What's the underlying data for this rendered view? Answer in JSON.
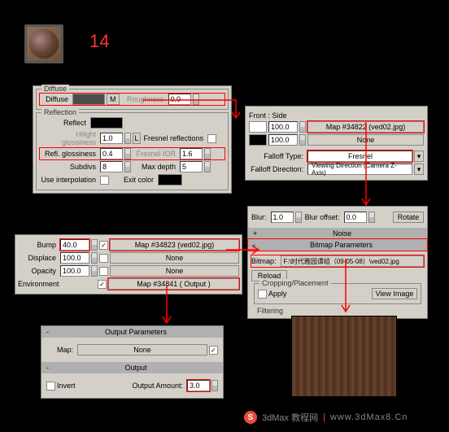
{
  "step": "14",
  "diffuse": {
    "title": "Diffuse",
    "label": "Diffuse",
    "map_btn": "M",
    "rough_label": "Roughness",
    "roughness": "0.0"
  },
  "reflection": {
    "title": "Reflection",
    "reflect_label": "Reflect",
    "hilight_label": "Hilight glossiness",
    "hilight": "1.0",
    "fresnel_r_label": "Fresnel reflections",
    "refl_gloss_label": "Refl. glossiness",
    "refl_gloss": "0.4",
    "fresnel_ior_label": "Fresnel IOR",
    "fresnel_ior": "1.6",
    "subdivs_label": "Subdivs",
    "subdivs": "8",
    "maxdepth_label": "Max depth",
    "maxdepth": "5",
    "useinterp_label": "Use interpolation",
    "exit_label": "Exit color"
  },
  "falloff": {
    "front_side": "Front : Side",
    "val1": "100.0",
    "map1": "Map #34822 (ved02.jpg)",
    "val2": "100.0",
    "map2": "None",
    "type_label": "Falloff Type:",
    "type": "Fresnel",
    "dir_label": "Falloff Direction:",
    "dir": "Viewing Direction (Camera Z-Axis)"
  },
  "bitmap_top": {
    "blur_label": "Blur:",
    "blur": "1.0",
    "offset_label": "Blur offset:",
    "offset": "0.0",
    "rotate": "Rotate",
    "noise": "Noise",
    "bitmap_params": "Bitmap Parameters",
    "bitmap_label": "Bitmap:",
    "bitmap_path": "F:\\时代雅园谭组（09-05-08）\\ved02.jpg",
    "reload": "Reload",
    "crop_label": "Cropping/Placement",
    "apply": "Apply",
    "view": "View Image",
    "filtering": "Filtering"
  },
  "bump_panel": {
    "bump_label": "Bump",
    "bump": "40.0",
    "bump_map": "Map #34823 (ved02.jpg)",
    "disp_label": "Displace",
    "disp": "100.0",
    "disp_map": "None",
    "op_label": "Opacity",
    "op": "100.0",
    "op_map": "None",
    "env_label": "Environment",
    "env_map": "Map #34841  ( Output )"
  },
  "output": {
    "title": "Output Parameters",
    "map_label": "Map:",
    "map": "None",
    "out_title": "Output",
    "invert_label": "Invert",
    "amount_label": "Output Amount:",
    "amount": "3.0"
  },
  "watermark": {
    "site": "3dMax 教程网",
    "url": "www.3dMax8.Cn"
  }
}
